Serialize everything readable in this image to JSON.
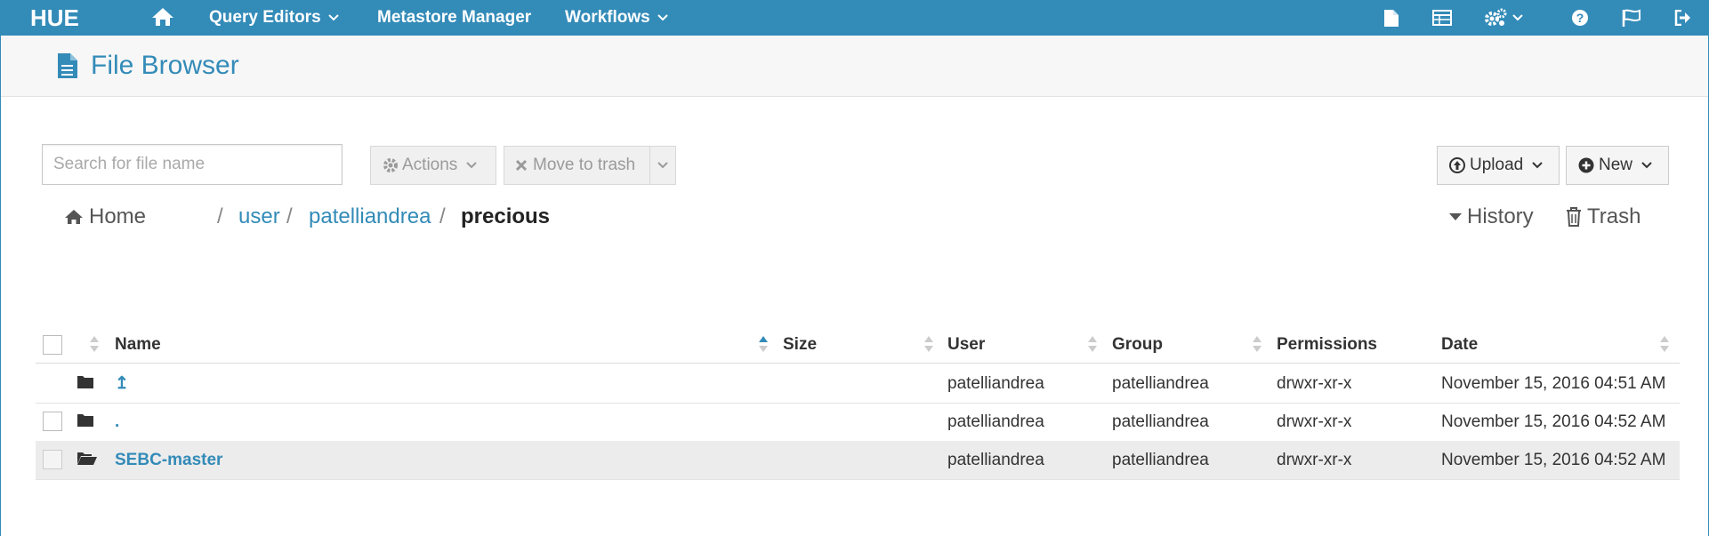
{
  "nav": {
    "logo": "HUE",
    "query_editors": "Query Editors",
    "metastore": "Metastore Manager",
    "workflows": "Workflows"
  },
  "page": {
    "title": "File Browser"
  },
  "toolbar": {
    "search_placeholder": "Search for file name",
    "actions_label": "Actions",
    "move_to_trash_label": "Move to trash",
    "upload_label": "Upload",
    "new_label": "New"
  },
  "breadcrumb": {
    "home": "Home",
    "parts": [
      "user",
      "patelliandrea"
    ],
    "current": "precious",
    "separator": "/"
  },
  "header_links": {
    "history": "History",
    "trash": "Trash"
  },
  "table": {
    "columns": [
      "Name",
      "Size",
      "User",
      "Group",
      "Permissions",
      "Date"
    ],
    "rows": [
      {
        "name": "↥",
        "size": "",
        "user": "patelliandrea",
        "group": "patelliandrea",
        "permissions": "drwxr-xr-x",
        "date": "November 15, 2016 04:51 AM"
      },
      {
        "name": ".",
        "size": "",
        "user": "patelliandrea",
        "group": "patelliandrea",
        "permissions": "drwxr-xr-x",
        "date": "November 15, 2016 04:52 AM"
      },
      {
        "name": "SEBC-master",
        "size": "",
        "user": "patelliandrea",
        "group": "patelliandrea",
        "permissions": "drwxr-xr-x",
        "date": "November 15, 2016 04:52 AM"
      }
    ]
  },
  "colors": {
    "brand": "#338bb8",
    "row_selected": "#ececec"
  },
  "icons": [
    "home-icon",
    "document-icon",
    "table-icon",
    "gears-icon",
    "help-icon",
    "flag-icon",
    "sign-out-icon",
    "file-icon",
    "cog-icon",
    "times-icon",
    "upload-circle-icon",
    "plus-circle-icon",
    "home-crumb-icon",
    "caret-down-icon",
    "trash-icon",
    "folder-icon",
    "folder-open-icon",
    "level-up-icon"
  ]
}
